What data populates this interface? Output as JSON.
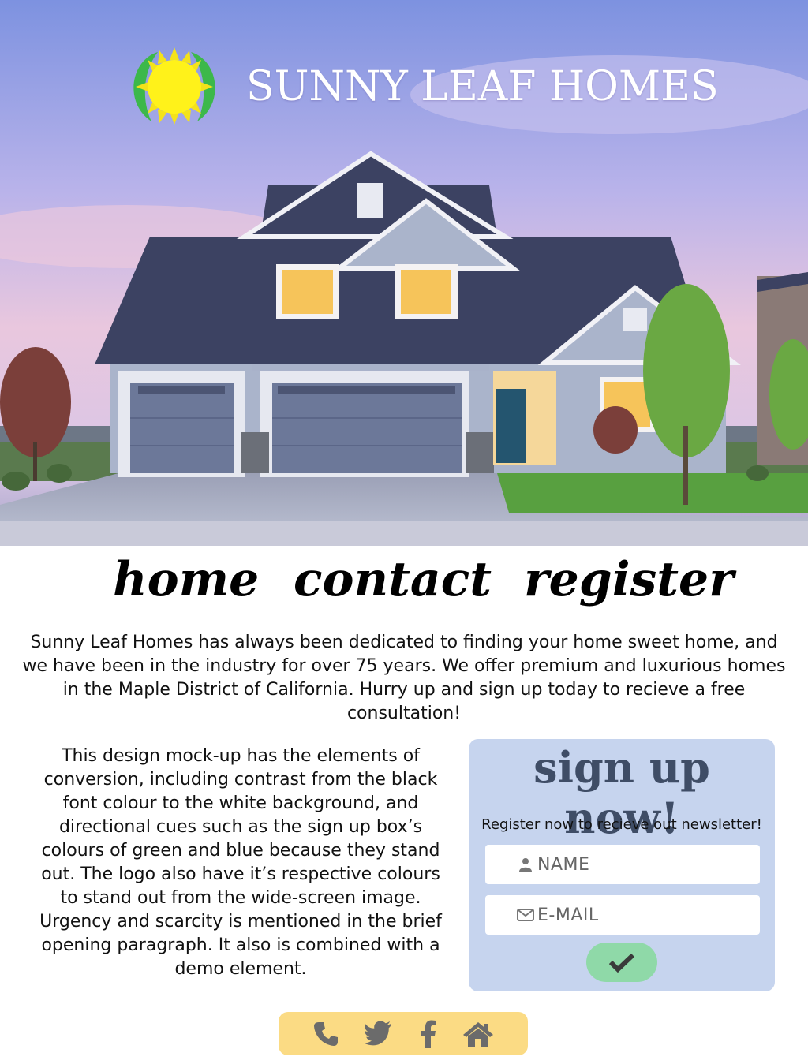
{
  "colors": {
    "brand_sun": "#fff21a",
    "brand_leaf": "#3cb84a",
    "signup_bg": "#c6d4ee",
    "signup_title": "#3f4d66",
    "submit_bg": "#8fd9a8",
    "social_bg": "#fbdb84",
    "social_icon": "#6b6b6b"
  },
  "header": {
    "brand_name": "SUNNY LEAF HOMES",
    "logo_icon": "sun-leaf-logo-icon",
    "hero_image": "house-photo"
  },
  "nav": {
    "items": [
      {
        "label": "home"
      },
      {
        "label": "contact"
      },
      {
        "label": "register"
      }
    ]
  },
  "intro": {
    "text": "Sunny Leaf Homes has always been dedicated to finding your home sweet home, and we have been in the industry for over 75 years. We offer premium and luxurious homes in the Maple District of California. Hurry up and sign up today to recieve a free consultation!"
  },
  "mockup_note": {
    "text": "This design mock-up has the elements of conversion, including contrast from the black font colour to the white background, and directional cues such as the sign up box’s colours of green and blue because they stand out. The logo also have it’s respective colours to stand out from the wide-screen image. Urgency and scarcity is mentioned in the brief opening paragraph. It also is combined with a demo element."
  },
  "signup": {
    "title": "sign up now!",
    "subtitle": "Register now to recieve out newsletter!",
    "name_placeholder": "NAME",
    "name_icon": "user-icon",
    "email_placeholder": "E-MAIL",
    "email_icon": "envelope-icon",
    "submit_icon": "checkmark-icon"
  },
  "social": {
    "icons": [
      "phone-icon",
      "twitter-icon",
      "facebook-icon",
      "home-icon"
    ]
  }
}
